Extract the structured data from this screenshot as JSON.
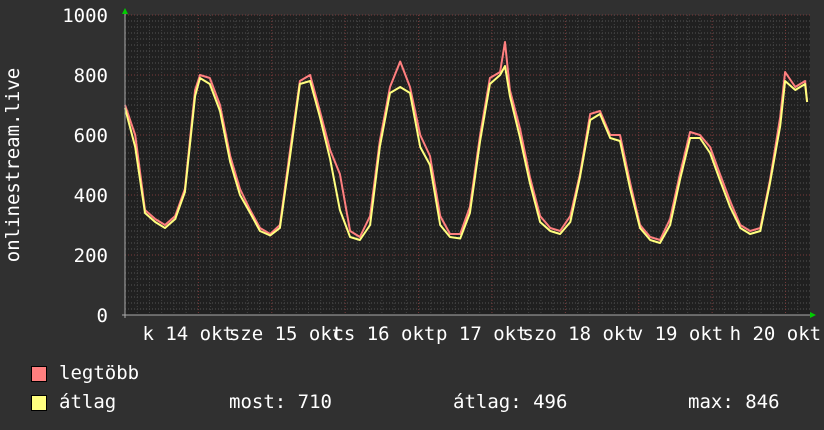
{
  "chart_data": {
    "type": "line",
    "title": "",
    "ylabel": "onlinestream.live",
    "xlabel": "",
    "ylim": [
      0,
      1000
    ],
    "xlim": [
      0,
      168
    ],
    "x_unit": "hours",
    "yticks": [
      "0",
      "200",
      "400",
      "600",
      "800",
      "1000"
    ],
    "xticks": [
      {
        "label": "k 14 okt",
        "x": 15.5
      },
      {
        "label": "sze 15 okt",
        "x": 39.5
      },
      {
        "label": "cs 16 okt",
        "x": 63.5
      },
      {
        "label": "p 17 okt",
        "x": 87.5
      },
      {
        "label": "szo 18 okt",
        "x": 111.5
      },
      {
        "label": "v 19 okt",
        "x": 135.5
      },
      {
        "label": "h 20 okt",
        "x": 159.5
      }
    ],
    "grid": true,
    "x": [
      0,
      2.5,
      4.9,
      7.4,
      9.8,
      12.3,
      14.7,
      17.2,
      18.4,
      20.8,
      23.3,
      25.8,
      28.2,
      30.7,
      33.1,
      35.6,
      38,
      40.5,
      42.9,
      45.4,
      47.8,
      50.3,
      52.7,
      55.2,
      57.6,
      60.1,
      62.5,
      65,
      67.5,
      69.9,
      72.4,
      74.8,
      77.3,
      79.7,
      82.2,
      84.6,
      87.1,
      89.5,
      92,
      93.2,
      94.4,
      96.9,
      99.3,
      101.8,
      104.3,
      106.7,
      109.2,
      111.6,
      114.1,
      116.5,
      119,
      121.4,
      123.9,
      126.3,
      128.8,
      131.2,
      133.7,
      136.1,
      138.6,
      141,
      143.5,
      145.9,
      148.4,
      150.9,
      153.3,
      155.8,
      158.2,
      160.7,
      161.9,
      164.4,
      166.8,
      167.3
    ],
    "series": [
      {
        "name": "legtöbb",
        "color": "#ff7f7f",
        "values": [
          700,
          600,
          350,
          320,
          300,
          330,
          420,
          750,
          800,
          790,
          700,
          530,
          420,
          350,
          290,
          270,
          300,
          550,
          780,
          800,
          680,
          550,
          470,
          280,
          260,
          330,
          580,
          760,
          845,
          760,
          600,
          530,
          330,
          270,
          270,
          360,
          600,
          790,
          810,
          910,
          750,
          620,
          460,
          330,
          290,
          280,
          330,
          470,
          670,
          680,
          600,
          600,
          440,
          300,
          260,
          250,
          320,
          470,
          610,
          600,
          560,
          470,
          380,
          300,
          280,
          290,
          450,
          660,
          810,
          760,
          780,
          710
        ]
      },
      {
        "name": "átlag",
        "color": "#ffff7f",
        "values": [
          690,
          560,
          340,
          310,
          290,
          320,
          410,
          730,
          790,
          770,
          680,
          510,
          400,
          340,
          280,
          265,
          290,
          530,
          770,
          780,
          660,
          520,
          350,
          260,
          250,
          300,
          560,
          740,
          760,
          740,
          560,
          500,
          300,
          260,
          255,
          340,
          580,
          770,
          800,
          830,
          730,
          590,
          440,
          310,
          280,
          270,
          310,
          460,
          650,
          670,
          590,
          580,
          420,
          290,
          250,
          240,
          300,
          450,
          590,
          590,
          540,
          450,
          360,
          290,
          270,
          280,
          440,
          630,
          780,
          750,
          770,
          710
        ]
      }
    ]
  },
  "legend": {
    "items": [
      {
        "label": "legtöbb",
        "color": "#ff7f7f"
      },
      {
        "label": "átlag",
        "color": "#ffff7f"
      }
    ],
    "most": "most: 710",
    "atlag": "átlag: 496",
    "max": "max: 846"
  }
}
